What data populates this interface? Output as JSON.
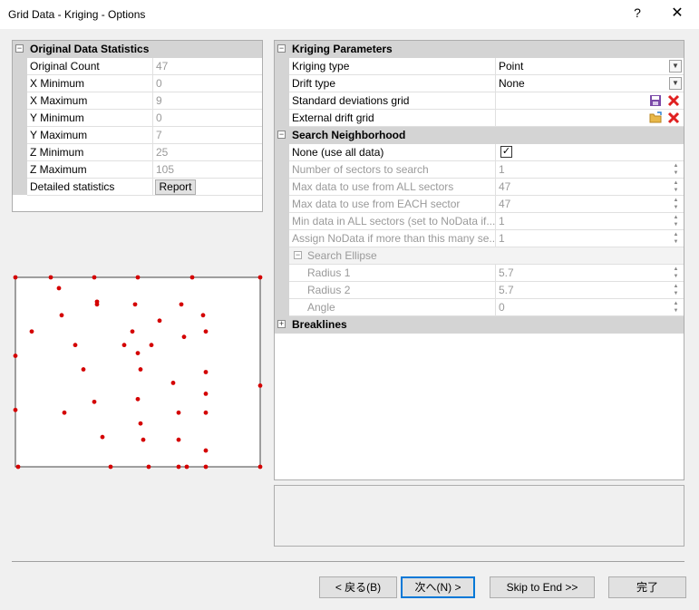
{
  "window": {
    "title": "Grid Data - Kriging - Options",
    "help": "?",
    "close": "✕"
  },
  "stats": {
    "header": "Original Data Statistics",
    "rows": [
      {
        "label": "Original Count",
        "value": "47"
      },
      {
        "label": "X Minimum",
        "value": "0"
      },
      {
        "label": "X Maximum",
        "value": "9"
      },
      {
        "label": "Y Minimum",
        "value": "0"
      },
      {
        "label": "Y Maximum",
        "value": "7"
      },
      {
        "label": "Z Minimum",
        "value": "25"
      },
      {
        "label": "Z Maximum",
        "value": "105"
      },
      {
        "label": "Detailed statistics",
        "value": ""
      }
    ],
    "report_button": "Report"
  },
  "scatter_points": [
    [
      0,
      7
    ],
    [
      1.3,
      7
    ],
    [
      2.9,
      7
    ],
    [
      4.5,
      7
    ],
    [
      6.5,
      7
    ],
    [
      9,
      7
    ],
    [
      1.6,
      6.6
    ],
    [
      3,
      6
    ],
    [
      4.4,
      6
    ],
    [
      6.1,
      6
    ],
    [
      1.7,
      5.6
    ],
    [
      6.9,
      5.6
    ],
    [
      5.3,
      5.4
    ],
    [
      7,
      5
    ],
    [
      0.6,
      5
    ],
    [
      4.3,
      5
    ],
    [
      6.2,
      4.8
    ],
    [
      2.2,
      4.5
    ],
    [
      4,
      4.5
    ],
    [
      5,
      4.5
    ],
    [
      4.5,
      4.2
    ],
    [
      0,
      4.1
    ],
    [
      2.5,
      3.6
    ],
    [
      4.6,
      3.6
    ],
    [
      7,
      3.5
    ],
    [
      5.8,
      3.1
    ],
    [
      9,
      3
    ],
    [
      7,
      2.7
    ],
    [
      2.9,
      2.4
    ],
    [
      4.5,
      2.5
    ],
    [
      0,
      2.1
    ],
    [
      1.8,
      2
    ],
    [
      6,
      2
    ],
    [
      7,
      2
    ],
    [
      4.6,
      1.6
    ],
    [
      3.2,
      1.1
    ],
    [
      4.7,
      1
    ],
    [
      6,
      1
    ],
    [
      7,
      0.6
    ],
    [
      0.1,
      0
    ],
    [
      3.5,
      0
    ],
    [
      4.9,
      0
    ],
    [
      6,
      0
    ],
    [
      6.3,
      0
    ],
    [
      7,
      0
    ],
    [
      9,
      0
    ],
    [
      3,
      6.1
    ]
  ],
  "kriging": {
    "header": "Kriging Parameters",
    "kriging_type": {
      "label": "Kriging type",
      "value": "Point"
    },
    "drift_type": {
      "label": "Drift type",
      "value": "None"
    },
    "std_grid": {
      "label": "Standard deviations grid",
      "value": ""
    },
    "ext_drift": {
      "label": "External drift grid",
      "value": ""
    }
  },
  "search": {
    "header": "Search Neighborhood",
    "none_use_all": {
      "label": "None (use all data)",
      "checked": true
    },
    "rows": [
      {
        "label": "Number of sectors to search",
        "value": "1"
      },
      {
        "label": "Max data to use from ALL sectors",
        "value": "47"
      },
      {
        "label": "Max data to use from EACH sector",
        "value": "47"
      },
      {
        "label": "Min data in ALL sectors (set to NoData if...",
        "value": "1"
      },
      {
        "label": "Assign NoData if more than this many se...",
        "value": "1"
      }
    ],
    "ellipse": {
      "header": "Search Ellipse",
      "rows": [
        {
          "label": "Radius 1",
          "value": "5.7"
        },
        {
          "label": "Radius 2",
          "value": "5.7"
        },
        {
          "label": "Angle",
          "value": "0"
        }
      ]
    }
  },
  "breaklines": {
    "header": "Breaklines"
  },
  "buttons": {
    "back": "< 戻る(B)",
    "next": "次へ(N) >",
    "skip": "Skip to End >>",
    "finish": "完了"
  },
  "colors": {
    "point": "#d40000",
    "section": "#d4d4d4",
    "accent": "#0078d7"
  }
}
